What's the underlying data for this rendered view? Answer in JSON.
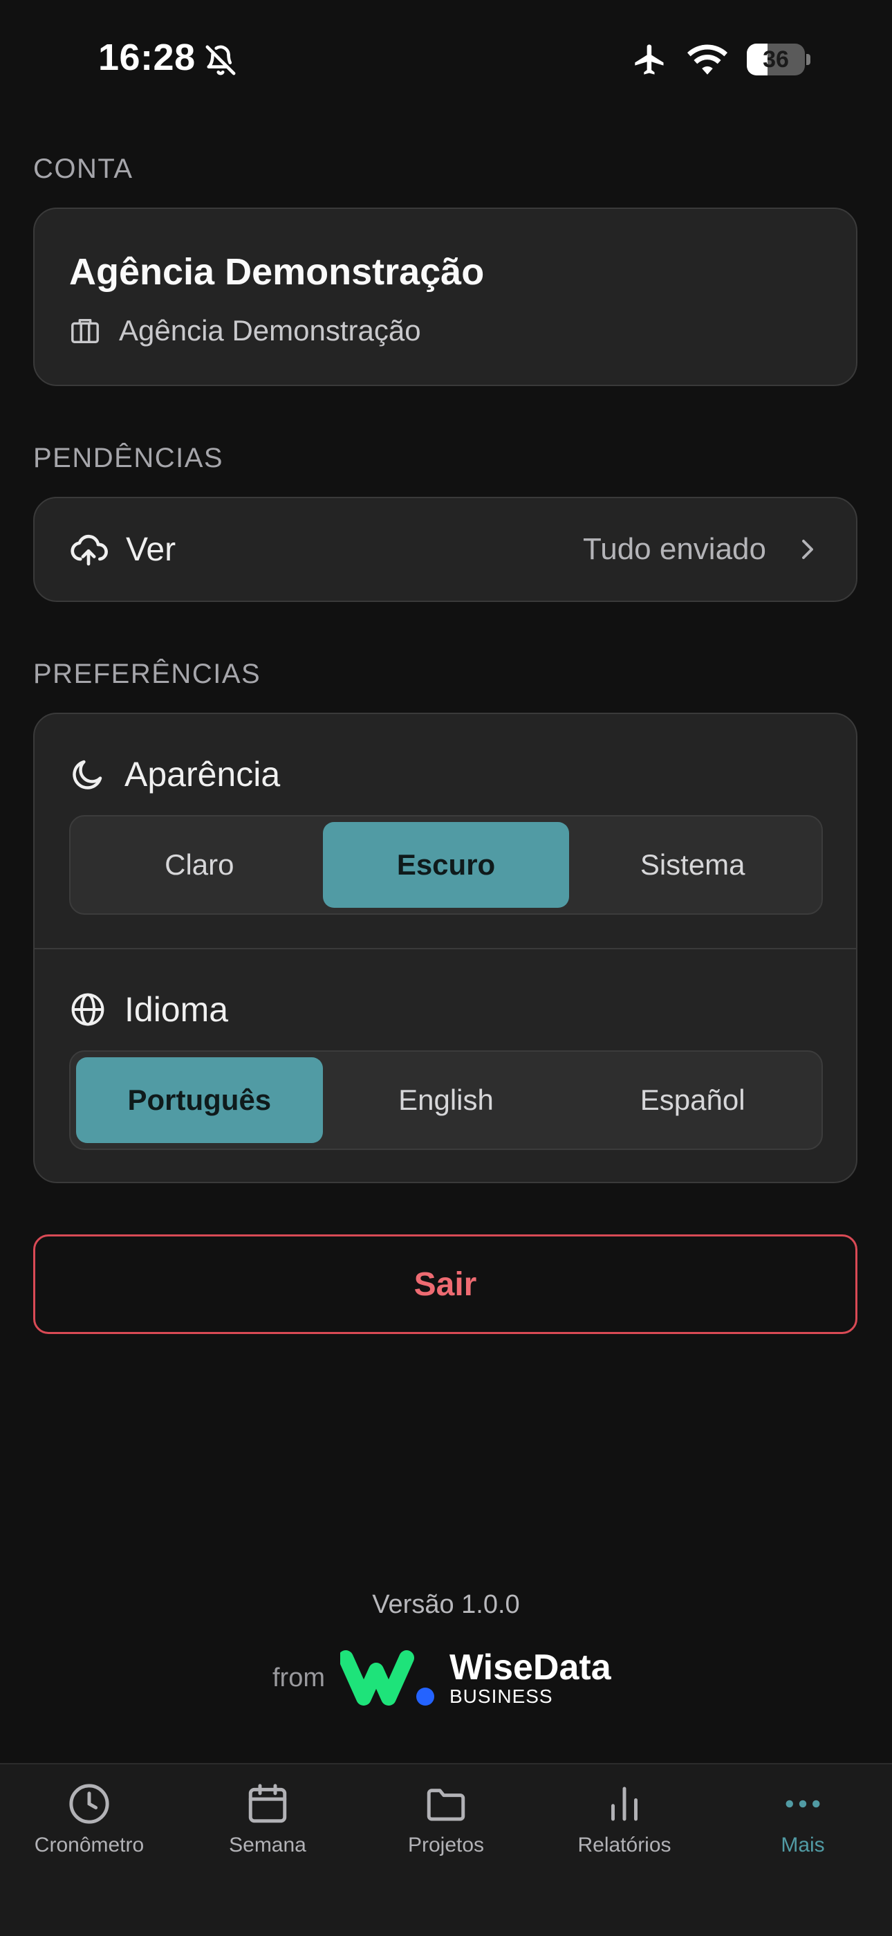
{
  "status_bar": {
    "time": "16:28",
    "battery": "36",
    "battery_level_percent": 36
  },
  "account": {
    "section_label": "CONTA",
    "name": "Agência Demonstração",
    "organization": "Agência Demonstração"
  },
  "pending": {
    "section_label": "PENDÊNCIAS",
    "action_label": "Ver",
    "status": "Tudo enviado"
  },
  "preferences": {
    "section_label": "PREFERÊNCIAS",
    "appearance": {
      "title": "Aparência",
      "options": [
        "Claro",
        "Escuro",
        "Sistema"
      ],
      "selected": "Escuro"
    },
    "language": {
      "title": "Idioma",
      "options": [
        "Português",
        "English",
        "Español"
      ],
      "selected": "Português"
    }
  },
  "logout_label": "Sair",
  "footer": {
    "version": "Versão 1.0.0",
    "from_label": "from",
    "brand_name": "WiseData",
    "brand_sub": "BUSINESS"
  },
  "colors": {
    "accent": "#519ba4",
    "danger": "#d94a55",
    "background": "#111111",
    "card": "#242424",
    "brand_green": "#1ee37a",
    "brand_blue": "#2463ff"
  },
  "tabs": [
    {
      "label": "Cronômetro",
      "icon": "clock-icon"
    },
    {
      "label": "Semana",
      "icon": "calendar-icon"
    },
    {
      "label": "Projetos",
      "icon": "folder-icon"
    },
    {
      "label": "Relatórios",
      "icon": "bar-chart-icon"
    },
    {
      "label": "Mais",
      "icon": "more-dots-icon",
      "active": true
    }
  ]
}
